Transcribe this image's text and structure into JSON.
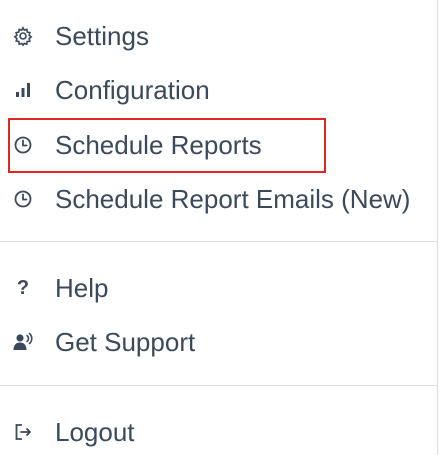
{
  "menu": {
    "items": [
      {
        "label": "Settings",
        "icon": "gear-icon"
      },
      {
        "label": "Configuration",
        "icon": "bar-chart-icon"
      },
      {
        "label": "Schedule Reports",
        "icon": "clock-icon"
      },
      {
        "label": "Schedule Report Emails (New)",
        "icon": "clock-icon"
      },
      {
        "label": "Help",
        "icon": "question-icon",
        "glyph": "?"
      },
      {
        "label": "Get Support",
        "icon": "support-users-icon"
      },
      {
        "label": "Logout",
        "icon": "logout-icon"
      }
    ]
  },
  "colors": {
    "text": "#3a4a5c",
    "divider": "#d9dde2",
    "highlight": "#e0261f"
  }
}
